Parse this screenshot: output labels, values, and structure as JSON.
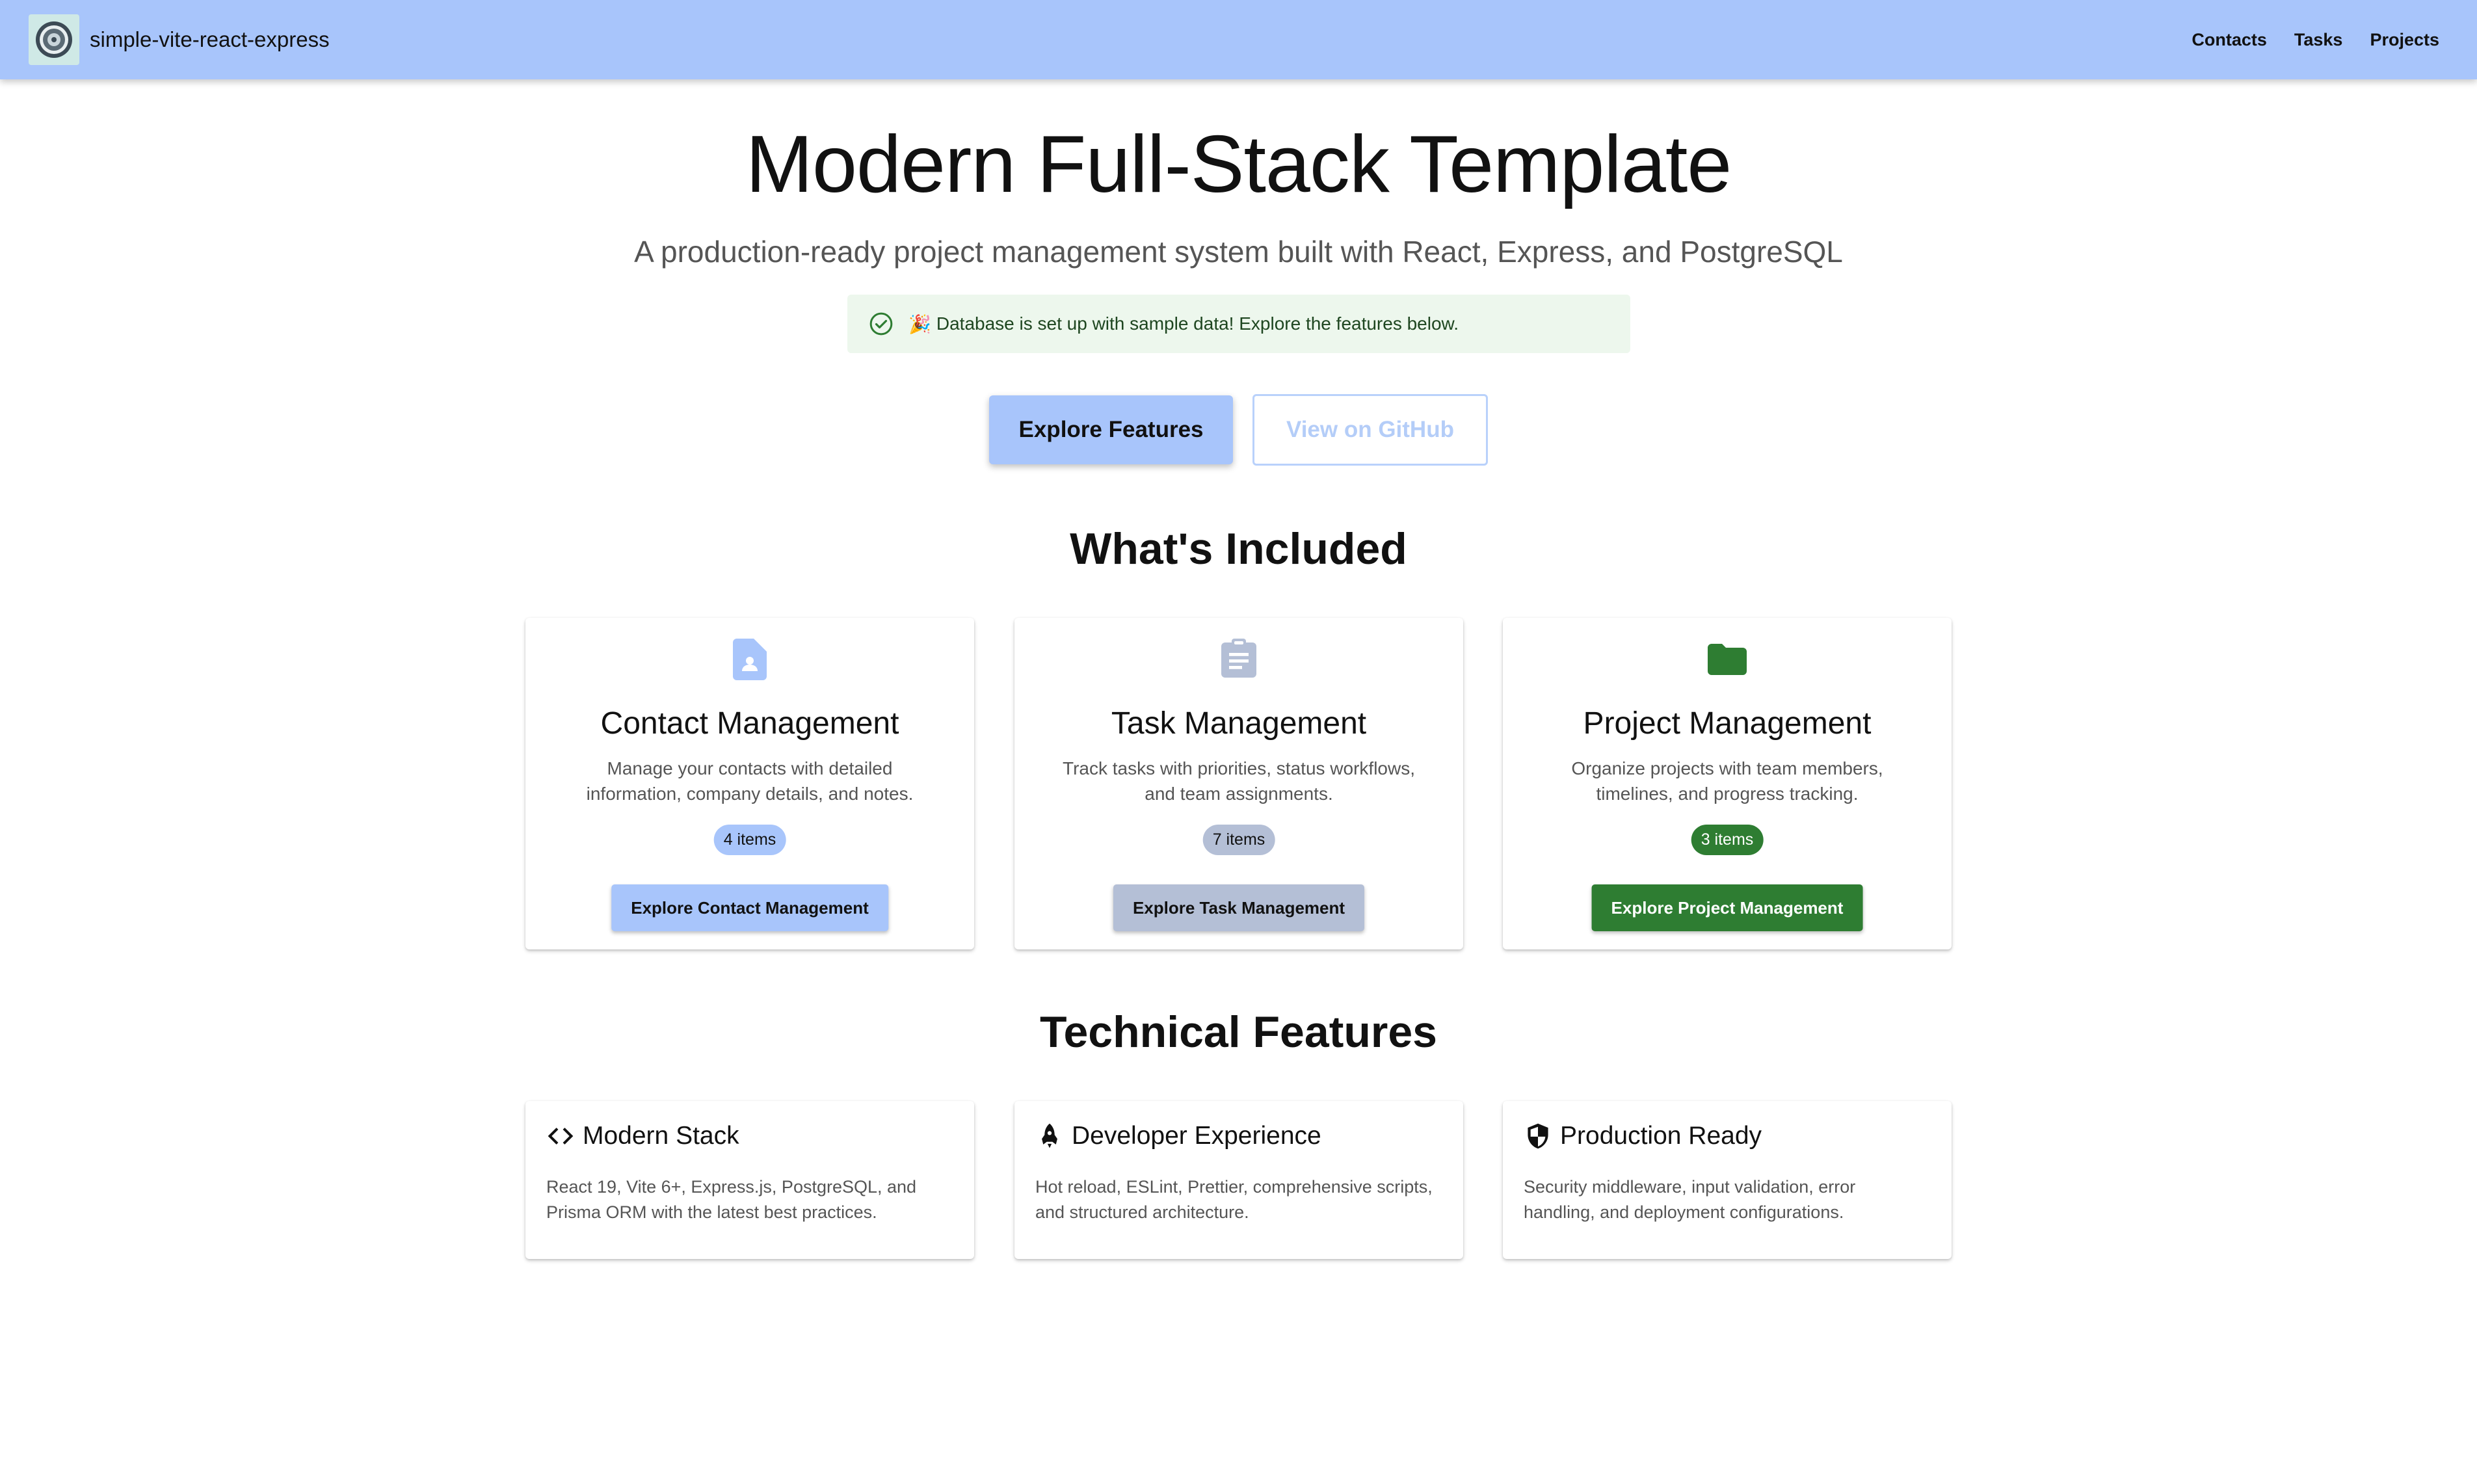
{
  "appbar": {
    "brand": "simple-vite-react-express",
    "nav": [
      "Contacts",
      "Tasks",
      "Projects"
    ]
  },
  "hero": {
    "title": "Modern Full-Stack Template",
    "subtitle": "A production-ready project management system built with React, Express, and PostgreSQL",
    "alert": {
      "emoji": "🎉",
      "text": "Database is set up with sample data! Explore the features below.",
      "icon": "check-circle-icon",
      "color": "#2e7d32"
    },
    "primary_button": "Explore Features",
    "secondary_button": "View on GitHub"
  },
  "included": {
    "title": "What's Included",
    "cards": [
      {
        "icon": "contact-document-icon",
        "title": "Contact Management",
        "description": "Manage your contacts with detailed information, company details, and notes.",
        "chip": "4 items",
        "button": "Explore Contact Management",
        "accent": "#a8c5fb",
        "accent_text": "#111111"
      },
      {
        "icon": "clipboard-icon",
        "title": "Task Management",
        "description": "Track tasks with priorities, status workflows, and team assignments.",
        "chip": "7 items",
        "button": "Explore Task Management",
        "accent": "#b4bfd6",
        "accent_text": "#111111"
      },
      {
        "icon": "folder-icon",
        "title": "Project Management",
        "description": "Organize projects with team members, timelines, and progress tracking.",
        "chip": "3 items",
        "button": "Explore Project Management",
        "accent": "#2e7d32",
        "accent_text": "#ffffff"
      }
    ]
  },
  "technical": {
    "title": "Technical Features",
    "cards": [
      {
        "icon": "code-icon",
        "title": "Modern Stack",
        "description": "React 19, Vite 6+, Express.js, PostgreSQL, and Prisma ORM with the latest best practices."
      },
      {
        "icon": "rocket-icon",
        "title": "Developer Experience",
        "description": "Hot reload, ESLint, Prettier, comprehensive scripts, and structured architecture."
      },
      {
        "icon": "shield-icon",
        "title": "Production Ready",
        "description": "Security middleware, input validation, error handling, and deployment configurations."
      }
    ]
  }
}
